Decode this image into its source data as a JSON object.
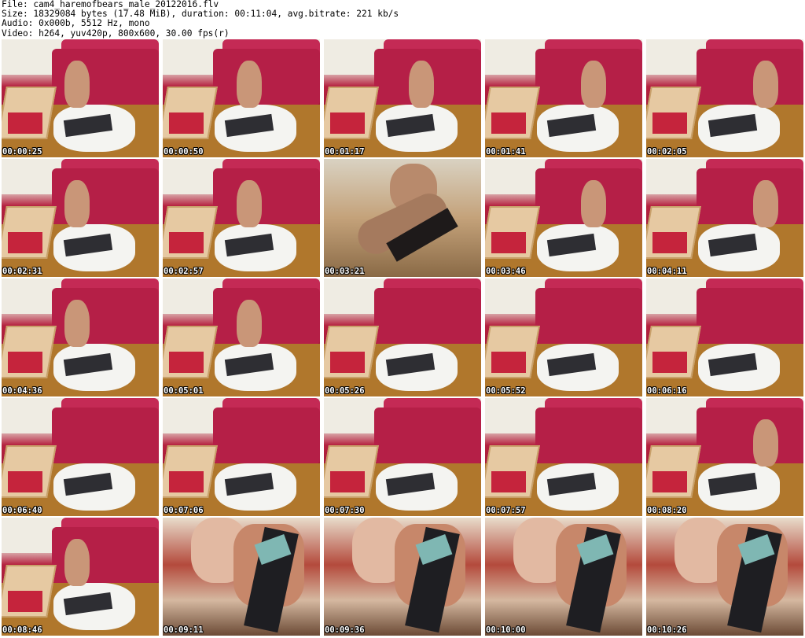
{
  "header": {
    "file_line": "File: cam4_haremofbears_male_20122016.flv",
    "size_line": "Size: 18329084 bytes (17.48 MiB), duration: 00:11:04, avg.bitrate: 221 kb/s",
    "audio_line": "Audio: 0x000b, 5512 Hz, mono",
    "video_line": "Video: h264, yuv420p, 800x600, 30.00 fps(r)"
  },
  "thumbnails": [
    {
      "time": "00:00:25",
      "scene": "room"
    },
    {
      "time": "00:00:50",
      "scene": "room"
    },
    {
      "time": "00:01:17",
      "scene": "room"
    },
    {
      "time": "00:01:41",
      "scene": "room"
    },
    {
      "time": "00:02:05",
      "scene": "room"
    },
    {
      "time": "00:02:31",
      "scene": "room"
    },
    {
      "time": "00:02:57",
      "scene": "room"
    },
    {
      "time": "00:03:21",
      "scene": "closeup"
    },
    {
      "time": "00:03:46",
      "scene": "room"
    },
    {
      "time": "00:04:11",
      "scene": "room"
    },
    {
      "time": "00:04:36",
      "scene": "room"
    },
    {
      "time": "00:05:01",
      "scene": "room"
    },
    {
      "time": "00:05:26",
      "scene": "room"
    },
    {
      "time": "00:05:52",
      "scene": "room"
    },
    {
      "time": "00:06:16",
      "scene": "room"
    },
    {
      "time": "00:06:40",
      "scene": "room"
    },
    {
      "time": "00:07:06",
      "scene": "room"
    },
    {
      "time": "00:07:30",
      "scene": "room"
    },
    {
      "time": "00:07:57",
      "scene": "room"
    },
    {
      "time": "00:08:20",
      "scene": "room"
    },
    {
      "time": "00:08:46",
      "scene": "room"
    },
    {
      "time": "00:09:11",
      "scene": "camera"
    },
    {
      "time": "00:09:36",
      "scene": "camera"
    },
    {
      "time": "00:10:00",
      "scene": "camera"
    },
    {
      "time": "00:10:26",
      "scene": "camera"
    }
  ]
}
